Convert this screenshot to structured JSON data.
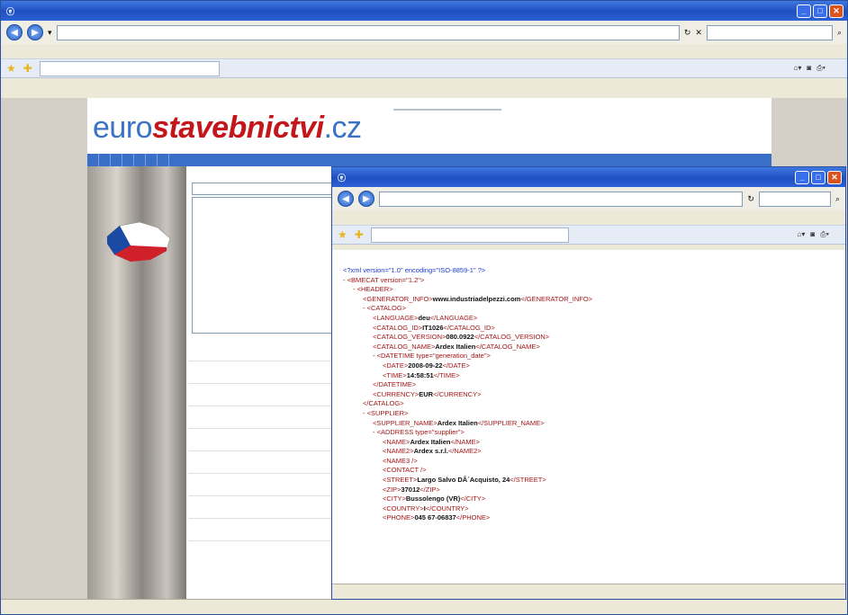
{
  "main_window": {
    "title": "",
    "url": "",
    "search_placeholder": "",
    "menu": [
      "",
      "",
      "",
      "",
      "",
      ""
    ],
    "tab_title": "",
    "tools": [
      "",
      "",
      ""
    ],
    "status_text": "",
    "zone": "",
    "zoom": ""
  },
  "site": {
    "logo_prefix": "euro",
    "logo_main": "stavebnictvi",
    "logo_suffix": ".cz",
    "tagline": "",
    "nav": [
      "",
      "",
      "",
      "",
      "",
      "",
      ""
    ],
    "catalog_title": "",
    "select_label": "",
    "select_value": "",
    "list_items": [
      "",
      "",
      "",
      "",
      "",
      "",
      "",
      "",
      "",
      "",
      "",
      "",
      "",
      "",
      ""
    ],
    "selected_index": 8,
    "rows": [
      "",
      "",
      "",
      "",
      "",
      "",
      "",
      "",
      ""
    ]
  },
  "popup": {
    "title": "",
    "url": "",
    "search_placeholder": "",
    "menu": [
      "",
      "",
      "",
      "",
      "",
      ""
    ],
    "tab_title": "",
    "tools": [
      "",
      ""
    ],
    "zone": "",
    "zoom": "",
    "xml_lines": [
      {
        "indent": 0,
        "open": "<?xml version=\"1.0\" encoding=\"ISO-8859-1\" ?>",
        "value": "",
        "close": "",
        "pi": true
      },
      {
        "indent": 0,
        "open": "- <BMECAT version=\"1.2\">",
        "value": "",
        "close": ""
      },
      {
        "indent": 1,
        "open": "- <HEADER>",
        "value": "",
        "close": ""
      },
      {
        "indent": 2,
        "open": "<GENERATOR_INFO>",
        "value": "www.industriadelpezzi.com",
        "close": "</GENERATOR_INFO>"
      },
      {
        "indent": 2,
        "open": "- <CATALOG>",
        "value": "",
        "close": ""
      },
      {
        "indent": 3,
        "open": "<LANGUAGE>",
        "value": "deu",
        "close": "</LANGUAGE>"
      },
      {
        "indent": 3,
        "open": "<CATALOG_ID>",
        "value": "IT1026",
        "close": "</CATALOG_ID>"
      },
      {
        "indent": 3,
        "open": "<CATALOG_VERSION>",
        "value": "080.0922",
        "close": "</CATALOG_VERSION>"
      },
      {
        "indent": 3,
        "open": "<CATALOG_NAME>",
        "value": "Ardex Italien",
        "close": "</CATALOG_NAME>"
      },
      {
        "indent": 3,
        "open": "- <DATETIME type=\"generation_date\">",
        "value": "",
        "close": ""
      },
      {
        "indent": 4,
        "open": "<DATE>",
        "value": "2008-09-22",
        "close": "</DATE>"
      },
      {
        "indent": 4,
        "open": "<TIME>",
        "value": "14:58:51",
        "close": "</TIME>"
      },
      {
        "indent": 3,
        "open": "</DATETIME>",
        "value": "",
        "close": ""
      },
      {
        "indent": 3,
        "open": "<CURRENCY>",
        "value": "EUR",
        "close": "</CURRENCY>"
      },
      {
        "indent": 2,
        "open": "</CATALOG>",
        "value": "",
        "close": ""
      },
      {
        "indent": 2,
        "open": "- <SUPPLIER>",
        "value": "",
        "close": ""
      },
      {
        "indent": 3,
        "open": "<SUPPLIER_NAME>",
        "value": "Ardex Italien",
        "close": "</SUPPLIER_NAME>"
      },
      {
        "indent": 3,
        "open": "- <ADDRESS type=\"supplier\">",
        "value": "",
        "close": ""
      },
      {
        "indent": 4,
        "open": "<NAME>",
        "value": "Ardex Italien",
        "close": "</NAME>"
      },
      {
        "indent": 4,
        "open": "<NAME2>",
        "value": "Ardex s.r.l.",
        "close": "</NAME2>"
      },
      {
        "indent": 4,
        "open": "<NAME3 />",
        "value": "",
        "close": ""
      },
      {
        "indent": 4,
        "open": "<CONTACT />",
        "value": "",
        "close": ""
      },
      {
        "indent": 4,
        "open": "<STREET>",
        "value": "Largo Salvo DÂ´Acquisto, 24",
        "close": "</STREET>"
      },
      {
        "indent": 4,
        "open": "<ZIP>",
        "value": "37012",
        "close": "</ZIP>"
      },
      {
        "indent": 4,
        "open": "<CITY>",
        "value": "Bussolengo (VR)",
        "close": "</CITY>"
      },
      {
        "indent": 4,
        "open": "<COUNTRY>",
        "value": "I",
        "close": "</COUNTRY>"
      },
      {
        "indent": 4,
        "open": "<PHONE>",
        "value": "045 67-06837",
        "close": "</PHONE>"
      }
    ]
  },
  "colors": {
    "xp_blue": "#1f4fc0",
    "xml_tag": "#a31515",
    "xml_bracket": "#1a3fcc",
    "brand_red": "#c4171c",
    "brand_blue": "#3a72c7"
  }
}
